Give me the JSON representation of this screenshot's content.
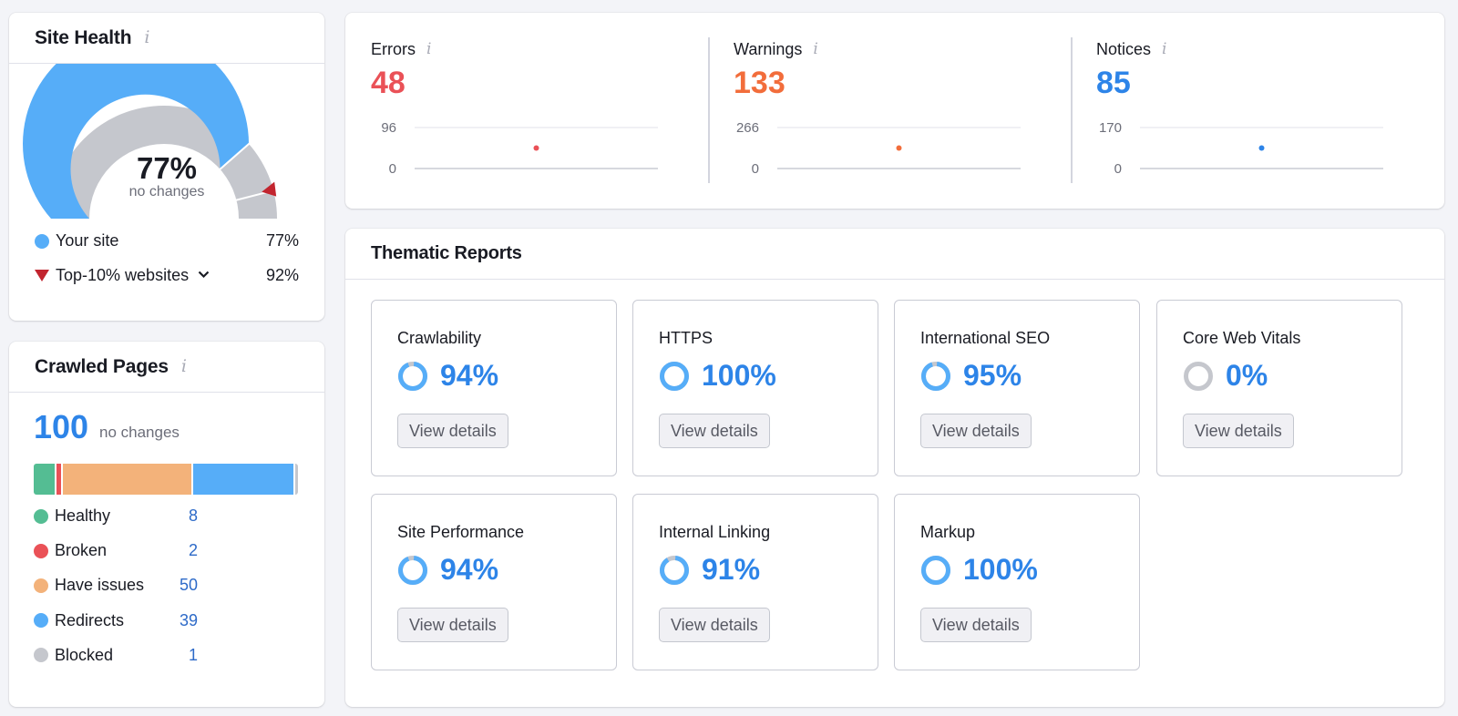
{
  "colors": {
    "blue": "#56adf8",
    "blue_text": "#2d84e8",
    "gray": "#c5c7cd",
    "red_marker": "#c2252f",
    "errors": "#ea5157",
    "warnings": "#f26d3b",
    "notices": "#2d84e8",
    "healthy": "#54bd93",
    "broken": "#ea5157",
    "issues": "#f3b27a",
    "redirects": "#56adf8",
    "blocked": "#c5c7cd"
  },
  "site_health": {
    "title": "Site Health",
    "info_icon": "i",
    "score": "77%",
    "score_value": 77,
    "top10_value": 92,
    "status": "no changes",
    "legend": [
      {
        "label": "Your site",
        "value": "77%"
      },
      {
        "label": "Top-10% websites",
        "value": "92%",
        "chevron": "⌄"
      }
    ]
  },
  "crawled_pages": {
    "title": "Crawled Pages",
    "info_icon": "i",
    "total": "100",
    "status": "no changes",
    "items": [
      {
        "label": "Healthy",
        "value": "8",
        "count": 8,
        "color": "#54bd93"
      },
      {
        "label": "Broken",
        "value": "2",
        "count": 2,
        "color": "#ea5157"
      },
      {
        "label": "Have issues",
        "value": "50",
        "count": 50,
        "color": "#f3b27a"
      },
      {
        "label": "Redirects",
        "value": "39",
        "count": 39,
        "color": "#56adf8"
      },
      {
        "label": "Blocked",
        "value": "1",
        "count": 1,
        "color": "#c5c7cd"
      }
    ]
  },
  "issues": [
    {
      "label": "Errors",
      "value": "48",
      "count": 48,
      "axis_max": "96",
      "axis_min": "0",
      "max": 96,
      "color": "#ea5157"
    },
    {
      "label": "Warnings",
      "value": "133",
      "count": 133,
      "axis_max": "266",
      "axis_min": "0",
      "max": 266,
      "color": "#f26d3b"
    },
    {
      "label": "Notices",
      "value": "85",
      "count": 85,
      "axis_max": "170",
      "axis_min": "0",
      "max": 170,
      "color": "#2d84e8"
    }
  ],
  "issues_info_icon": "i",
  "thematic": {
    "title": "Thematic Reports",
    "button_label": "View details",
    "reports": [
      {
        "name": "Crawlability",
        "pct": "94%",
        "value": 94
      },
      {
        "name": "HTTPS",
        "pct": "100%",
        "value": 100
      },
      {
        "name": "International SEO",
        "pct": "95%",
        "value": 95
      },
      {
        "name": "Core Web Vitals",
        "pct": "0%",
        "value": 0
      },
      {
        "name": "Site Performance",
        "pct": "94%",
        "value": 94
      },
      {
        "name": "Internal Linking",
        "pct": "91%",
        "value": 91
      },
      {
        "name": "Markup",
        "pct": "100%",
        "value": 100
      }
    ]
  }
}
